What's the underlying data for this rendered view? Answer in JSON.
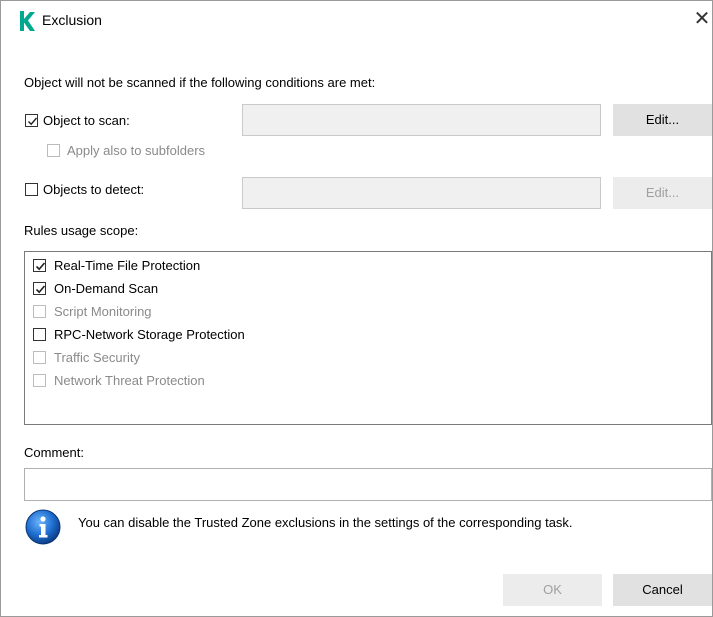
{
  "window": {
    "title": "Exclusion",
    "close_glyph": "✕",
    "accent": "#00a88e"
  },
  "intro": "Object will not be scanned if the following conditions are met:",
  "object_to_scan": {
    "label": "Object to scan:",
    "checked": true,
    "value": "",
    "edit_label": "Edit...",
    "subfolders_label": "Apply also to subfolders",
    "subfolders_checked": false
  },
  "objects_to_detect": {
    "label": "Objects to detect:",
    "checked": false,
    "value": "",
    "edit_label": "Edit..."
  },
  "scope": {
    "label": "Rules usage scope:",
    "items": [
      {
        "label": "Real-Time File Protection",
        "checked": true,
        "enabled": true
      },
      {
        "label": "On-Demand Scan",
        "checked": true,
        "enabled": true
      },
      {
        "label": "Script Monitoring",
        "checked": false,
        "enabled": false
      },
      {
        "label": "RPC-Network Storage Protection",
        "checked": false,
        "enabled": true
      },
      {
        "label": "Traffic Security",
        "checked": false,
        "enabled": false
      },
      {
        "label": "Network Threat Protection",
        "checked": false,
        "enabled": false
      }
    ]
  },
  "comment": {
    "label": "Comment:",
    "value": ""
  },
  "info_text": "You can disable the Trusted Zone exclusions in the settings of the corresponding task.",
  "buttons": {
    "ok": "OK",
    "cancel": "Cancel"
  }
}
